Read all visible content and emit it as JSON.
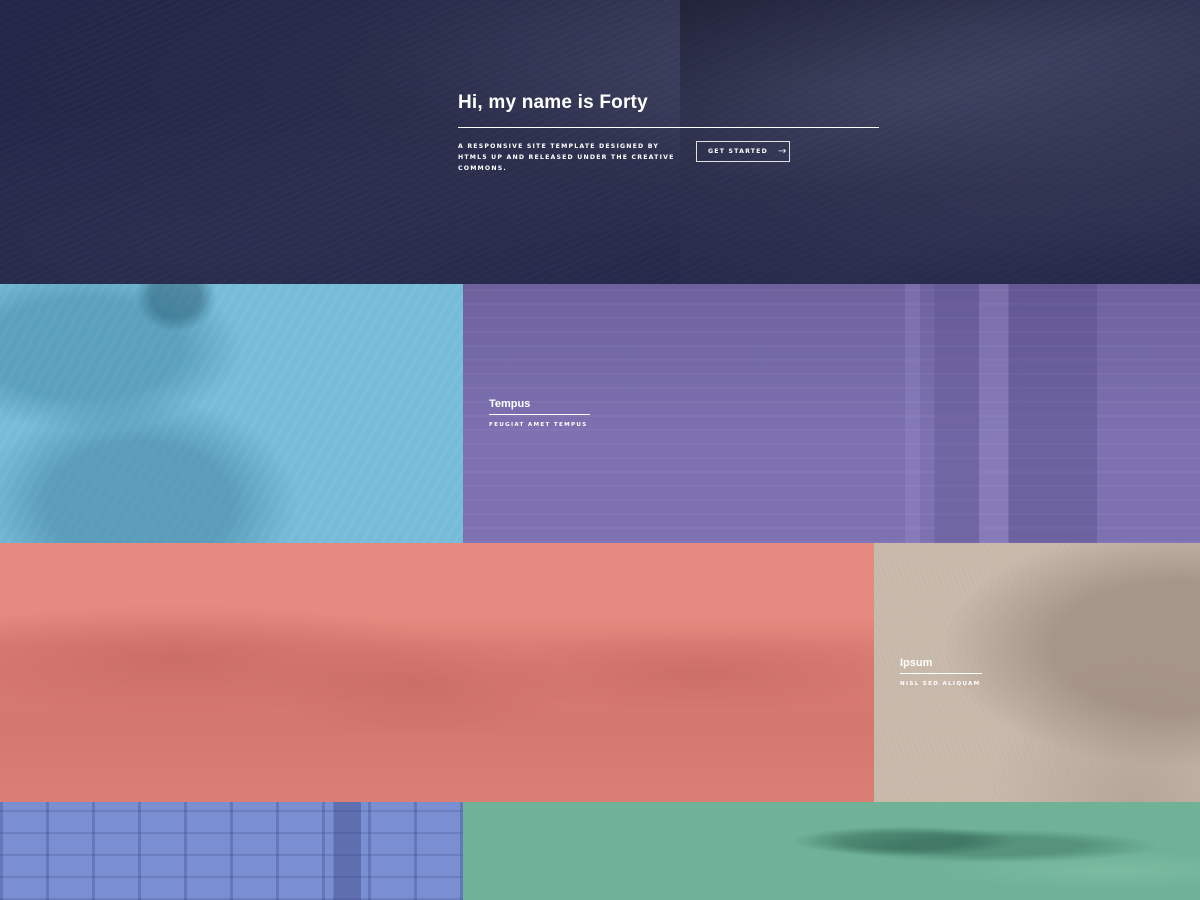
{
  "banner": {
    "title": "Hi, my name is Forty",
    "description": "A responsive site template designed by HTML5 UP and released under the Creative Commons.",
    "cta_label": "Get Started",
    "cta_arrow": "→"
  },
  "tiles": [
    {
      "title": "",
      "subtitle": "",
      "color": "#76bcd8"
    },
    {
      "title": "Tempus",
      "subtitle": "feugiat amet tempus",
      "color": "#7d71b1"
    },
    {
      "title": "",
      "subtitle": "",
      "color": "#e58a80"
    },
    {
      "title": "Ipsum",
      "subtitle": "Nisl sed aliquam",
      "color": "#c7b8aa"
    },
    {
      "title": "",
      "subtitle": "",
      "color": "#7a8fd2"
    },
    {
      "title": "",
      "subtitle": "",
      "color": "#6fb297"
    }
  ],
  "colors": {
    "banner_bg": "#242943"
  }
}
